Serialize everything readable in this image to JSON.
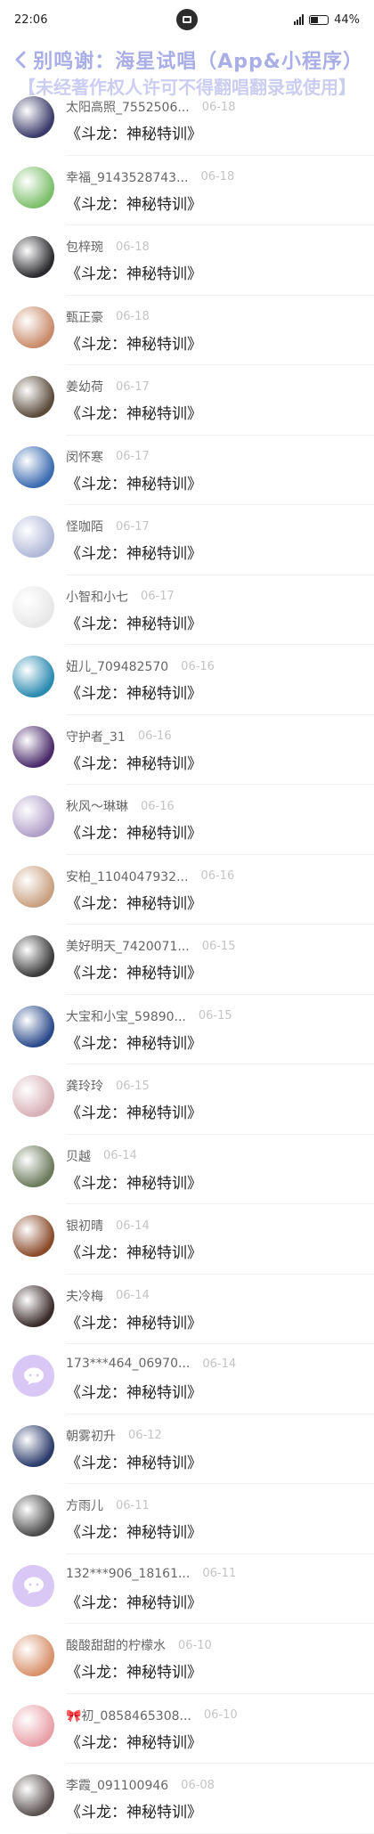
{
  "status_bar": {
    "time": "22:06",
    "battery": "44%"
  },
  "header": {
    "title": "别鸣谢：海星试唱（App&小程序）"
  },
  "notice": "【未经著作权人许可不得翻唱翻录或使用】",
  "colors": {
    "title": "#a9aee6",
    "notice": "#c2c6ee",
    "name": "#666666",
    "date": "#c4c4c4"
  },
  "comments": [
    {
      "name": "太阳高照_7552506...",
      "date": "06-18",
      "text": "《斗龙：神秘特训》",
      "avatar": "#3a3a6a"
    },
    {
      "name": "幸福_9143528743...",
      "date": "06-18",
      "text": "《斗龙：神秘特训》",
      "avatar": "#7cbf6a"
    },
    {
      "name": "包梓琬",
      "date": "06-18",
      "text": "《斗龙：神秘特训》",
      "avatar": "#2a2a2e"
    },
    {
      "name": "甄正豪",
      "date": "06-18",
      "text": "《斗龙：神秘特训》",
      "avatar": "#c98a6a"
    },
    {
      "name": "姜幼荷",
      "date": "06-17",
      "text": "《斗龙：神秘特训》",
      "avatar": "#5a4a3a"
    },
    {
      "name": "闵怀寒",
      "date": "06-17",
      "text": "《斗龙：神秘特训》",
      "avatar": "#3a6ab0"
    },
    {
      "name": "怪咖陌",
      "date": "06-17",
      "text": "《斗龙：神秘特训》",
      "avatar": "#b0b8d8"
    },
    {
      "name": "小智和小七",
      "date": "06-17",
      "text": "《斗龙：神秘特训》",
      "avatar": "#e8e8e8"
    },
    {
      "name": "妞儿_709482570",
      "date": "06-16",
      "text": "《斗龙：神秘特训》",
      "avatar": "#2a8ab0"
    },
    {
      "name": "守护者_31",
      "date": "06-16",
      "text": "《斗龙：神秘特训》",
      "avatar": "#4a2a6a"
    },
    {
      "name": "秋风～琳琳",
      "date": "06-16",
      "text": "《斗龙：神秘特训》",
      "avatar": "#b0a0c8"
    },
    {
      "name": "安柏_1104047932...",
      "date": "06-16",
      "text": "《斗龙：神秘特训》",
      "avatar": "#c8a080"
    },
    {
      "name": "美好明天_7420071...",
      "date": "06-15",
      "text": "《斗龙：神秘特训》",
      "avatar": "#3a3a3a"
    },
    {
      "name": "大宝和小宝_59890...",
      "date": "06-15",
      "text": "《斗龙：神秘特训》",
      "avatar": "#2a4a8a"
    },
    {
      "name": "龚玲玲",
      "date": "06-15",
      "text": "《斗龙：神秘特训》",
      "avatar": "#d8b0b8"
    },
    {
      "name": "贝越",
      "date": "06-14",
      "text": "《斗龙：神秘特训》",
      "avatar": "#6a7a5a"
    },
    {
      "name": "银初晴",
      "date": "06-14",
      "text": "《斗龙：神秘特训》",
      "avatar": "#8a4a2a"
    },
    {
      "name": "夫冷梅",
      "date": "06-14",
      "text": "《斗龙：神秘特训》",
      "avatar": "#3a2a2a"
    },
    {
      "name": "173***464_06970...",
      "date": "06-14",
      "text": "《斗龙：神秘特训》",
      "avatar": "wechat"
    },
    {
      "name": "朝雾初升",
      "date": "06-12",
      "text": "《斗龙：神秘特训》",
      "avatar": "#2a3a6a"
    },
    {
      "name": "方雨儿",
      "date": "06-11",
      "text": "《斗龙：神秘特训》",
      "avatar": "#4a4a4a"
    },
    {
      "name": "132***906_18161...",
      "date": "06-11",
      "text": "《斗龙：神秘特训》",
      "avatar": "wechat"
    },
    {
      "name": "酸酸甜甜的柠檬水",
      "date": "06-10",
      "text": "《斗龙：神秘特训》",
      "avatar": "#d8906a"
    },
    {
      "name": "🎀初_0858465308...",
      "date": "06-10",
      "text": "《斗龙：神秘特训》",
      "avatar": "#e8a0a8"
    },
    {
      "name": "李霞_091100946",
      "date": "06-08",
      "text": "《斗龙：神秘特训》",
      "avatar": "#5a5050"
    }
  ]
}
